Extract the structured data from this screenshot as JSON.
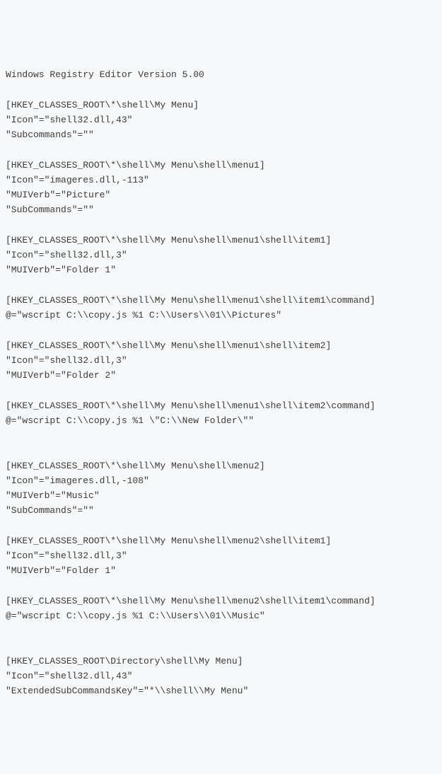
{
  "registry": {
    "header": "Windows Registry Editor Version 5.00",
    "blocks": [
      {
        "text": "\n[HKEY_CLASSES_ROOT\\*\\shell\\My Menu]\n\"Icon\"=\"shell32.dll,43\"\n\"Subcommands\"=\"\""
      },
      {
        "text": "\n[HKEY_CLASSES_ROOT\\*\\shell\\My Menu\\shell\\menu1]\n\"Icon\"=\"imageres.dll,-113\"\n\"MUIVerb\"=\"Picture\"\n\"SubCommands\"=\"\""
      },
      {
        "text": "\n[HKEY_CLASSES_ROOT\\*\\shell\\My Menu\\shell\\menu1\\shell\\item1]\n\"Icon\"=\"shell32.dll,3\"\n\"MUIVerb\"=\"Folder 1\""
      },
      {
        "text": "\n[HKEY_CLASSES_ROOT\\*\\shell\\My Menu\\shell\\menu1\\shell\\item1\\command]\n@=\"wscript C:\\\\copy.js %1 C:\\\\Users\\\\01\\\\Pictures\""
      },
      {
        "text": "\n[HKEY_CLASSES_ROOT\\*\\shell\\My Menu\\shell\\menu1\\shell\\item2]\n\"Icon\"=\"shell32.dll,3\"\n\"MUIVerb\"=\"Folder 2\""
      },
      {
        "text": "\n[HKEY_CLASSES_ROOT\\*\\shell\\My Menu\\shell\\menu1\\shell\\item2\\command]\n@=\"wscript C:\\\\copy.js %1 \\\"C:\\\\New Folder\\\"\"\n"
      },
      {
        "text": "\n[HKEY_CLASSES_ROOT\\*\\shell\\My Menu\\shell\\menu2]\n\"Icon\"=\"imageres.dll,-108\"\n\"MUIVerb\"=\"Music\"\n\"SubCommands\"=\"\""
      },
      {
        "text": "\n[HKEY_CLASSES_ROOT\\*\\shell\\My Menu\\shell\\menu2\\shell\\item1]\n\"Icon\"=\"shell32.dll,3\"\n\"MUIVerb\"=\"Folder 1\""
      },
      {
        "text": "\n[HKEY_CLASSES_ROOT\\*\\shell\\My Menu\\shell\\menu2\\shell\\item1\\command]\n@=\"wscript C:\\\\copy.js %1 C:\\\\Users\\\\01\\\\Music\"\n"
      },
      {
        "text": "\n[HKEY_CLASSES_ROOT\\Directory\\shell\\My Menu]\n\"Icon\"=\"shell32.dll,43\"\n\"ExtendedSubCommandsKey\"=\"*\\\\shell\\\\My Menu\""
      }
    ]
  }
}
